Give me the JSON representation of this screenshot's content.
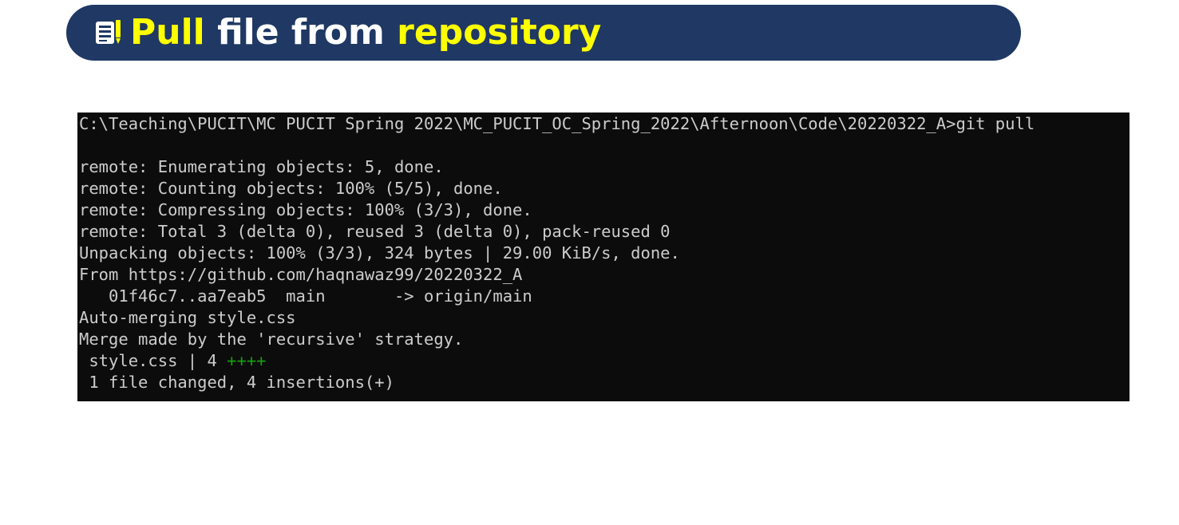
{
  "banner": {
    "icon": "document-edit-icon",
    "title_word1": "Pull",
    "title_word2": " file from ",
    "title_word3": "repository",
    "bg_color": "#1f3864",
    "highlight_color": "#ffff00"
  },
  "terminal": {
    "prompt": "C:\\Teaching\\PUCIT\\MC PUCIT Spring 2022\\MC_PUCIT_OC_Spring_2022\\Afternoon\\Code\\20220322_A>git pull",
    "lines": [
      "",
      "remote: Enumerating objects: 5, done.",
      "remote: Counting objects: 100% (5/5), done.",
      "remote: Compressing objects: 100% (3/3), done.",
      "remote: Total 3 (delta 0), reused 3 (delta 0), pack-reused 0",
      "Unpacking objects: 100% (3/3), 324 bytes | 29.00 KiB/s, done.",
      "From https://github.com/haqnawaz99/20220322_A",
      "   01f46c7..aa7eab5  main       -> origin/main",
      "Auto-merging style.css",
      "Merge made by the 'recursive' strategy."
    ],
    "diffstat_prefix": " style.css | 4 ",
    "diffstat_plus": "++++",
    "summary": " 1 file changed, 4 insertions(+)",
    "bg_color": "#0c0c0c",
    "text_color": "#cccccc",
    "plus_color": "#13a10e"
  }
}
